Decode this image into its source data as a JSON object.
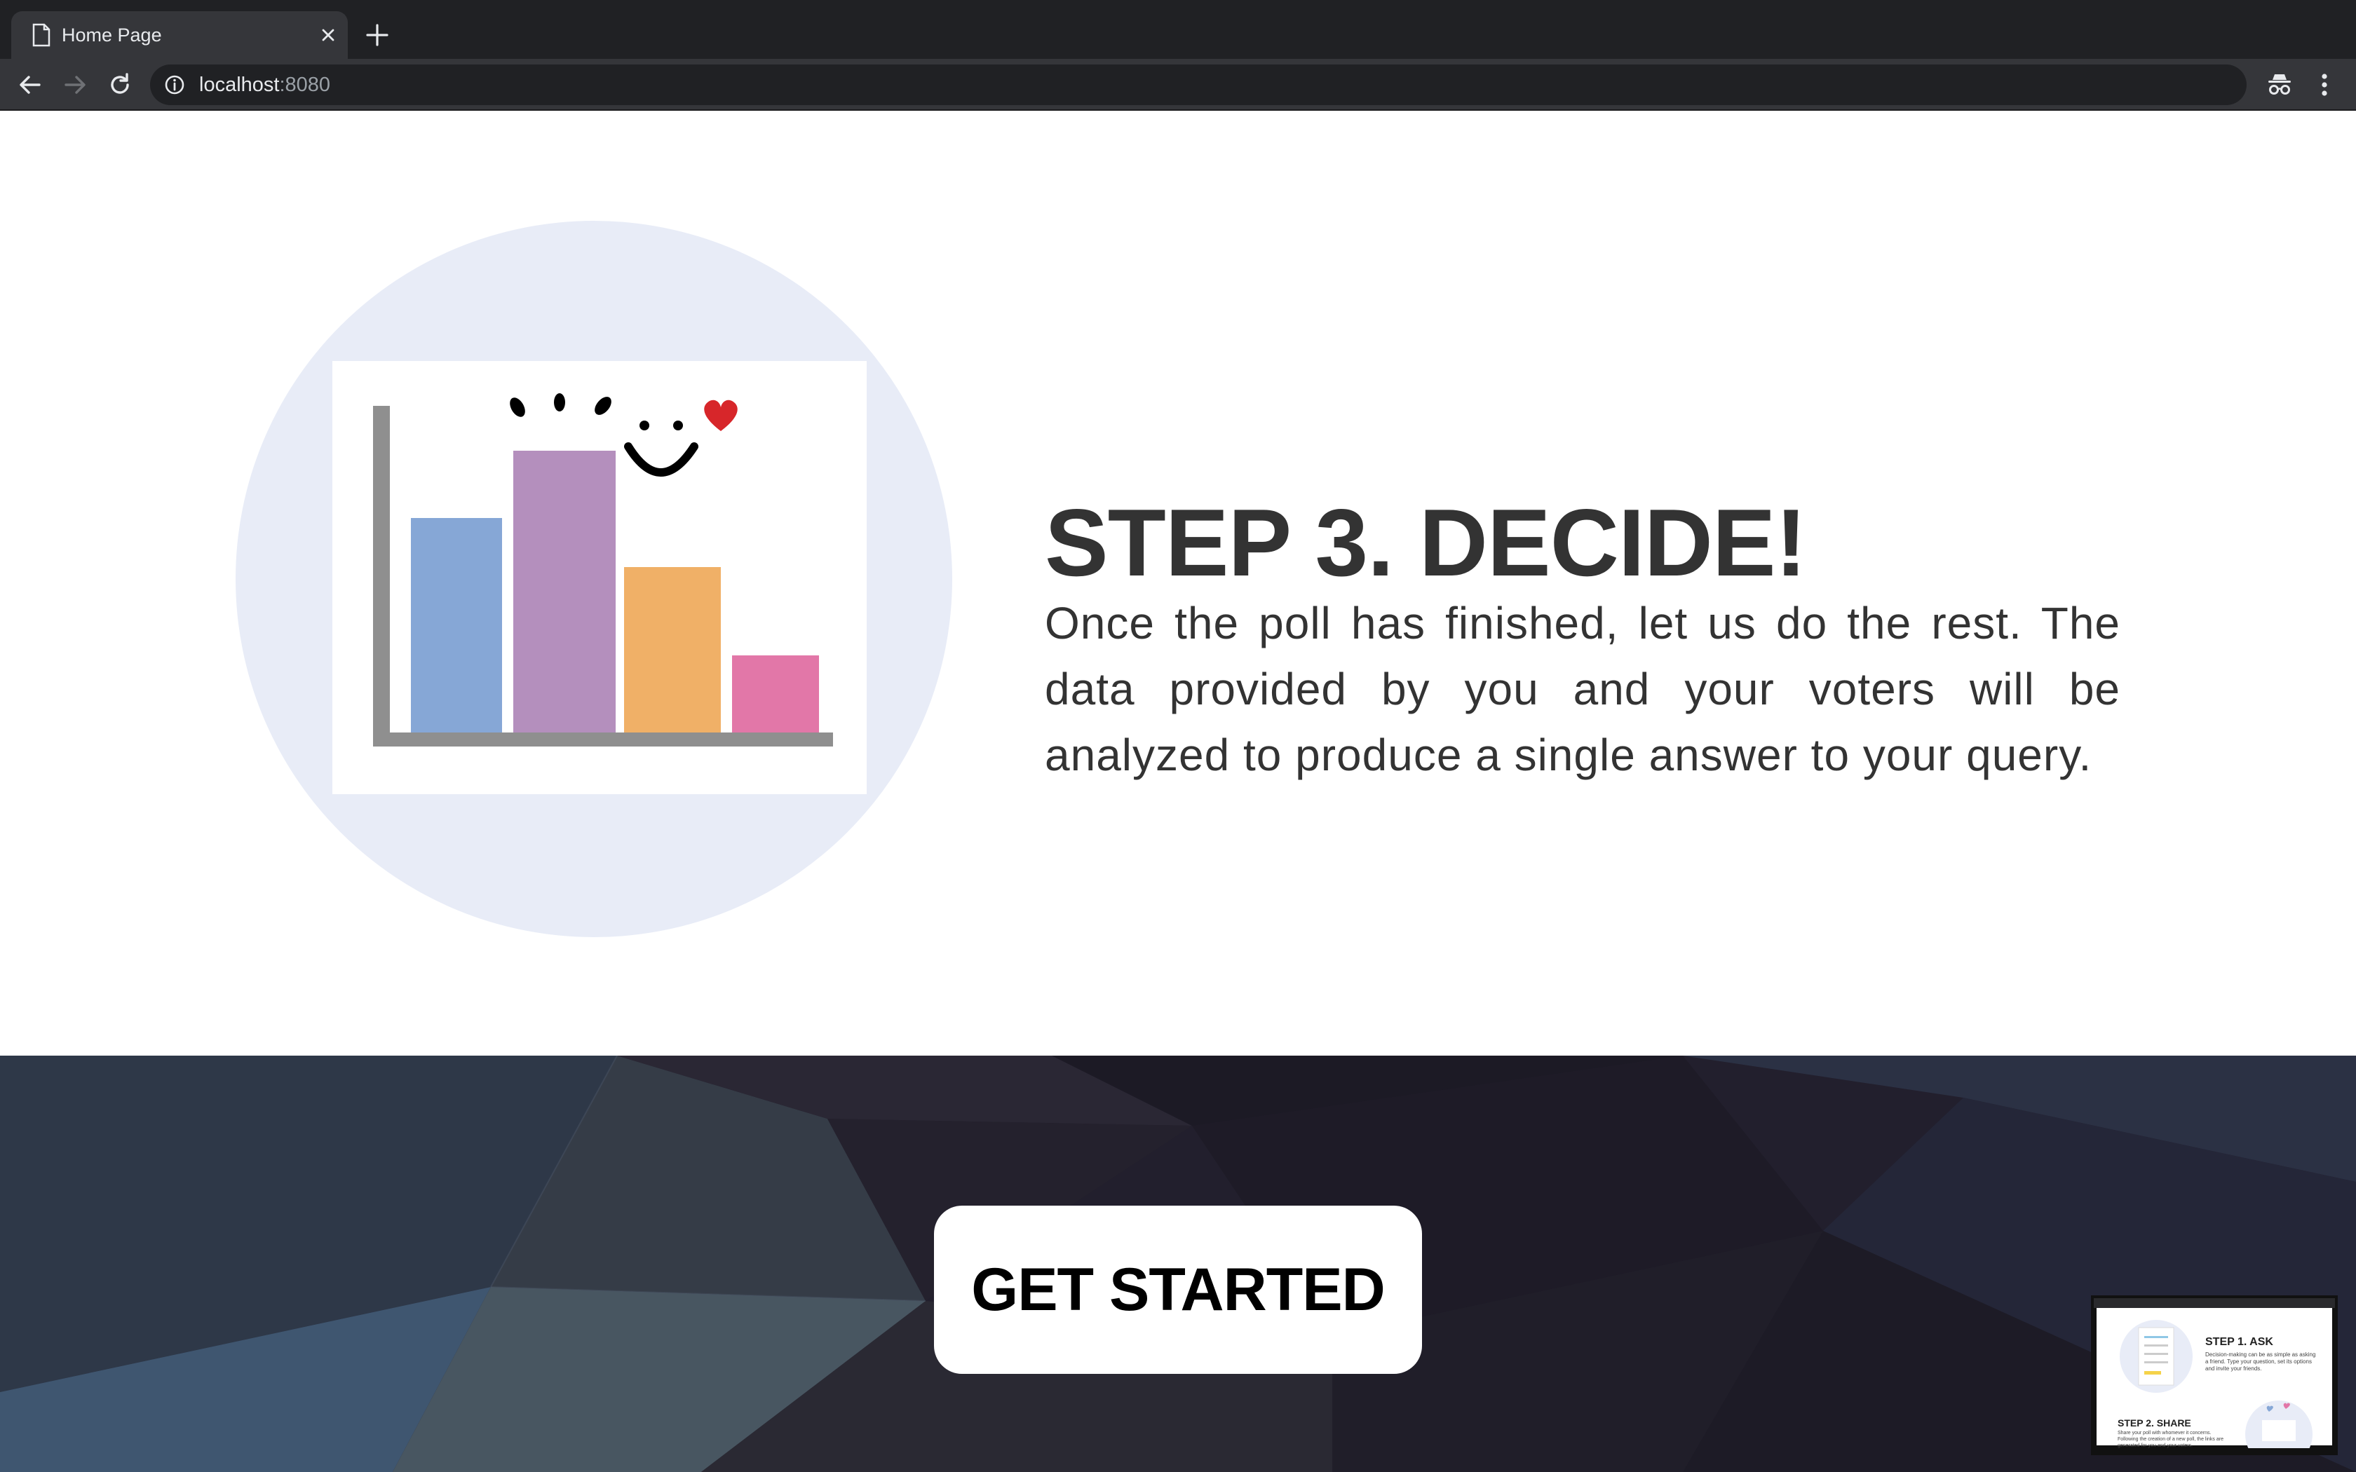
{
  "browser": {
    "tab_title": "Home Page",
    "url_host": "localhost",
    "url_port": ":8080"
  },
  "step": {
    "title": "STEP 3. DECIDE!",
    "description": "Once the poll has finished, let us do the rest. The data provided by you and your voters will be analyzed to produce a single answer to your query."
  },
  "cta": {
    "label": "GET STARTED"
  },
  "thumbnail": {
    "step1_title": "STEP 1. ASK",
    "step1_text": "Decision-making can be as simple as asking a friend. Type your question, set its options and invite your friends.",
    "step2_title": "STEP 2. SHARE",
    "step2_text": "Share your poll with whomever it concerns. Following the creation of a new poll, the links are generated for you and your voters."
  },
  "colors": {
    "circle_bg": "#e8ecf7",
    "bar_blue": "#86a7d6",
    "bar_purple": "#b48fbd",
    "bar_orange": "#f0b067",
    "bar_pink": "#e277a8",
    "axis": "#8f8f8f",
    "heart": "#d7262a",
    "text": "#333333"
  }
}
